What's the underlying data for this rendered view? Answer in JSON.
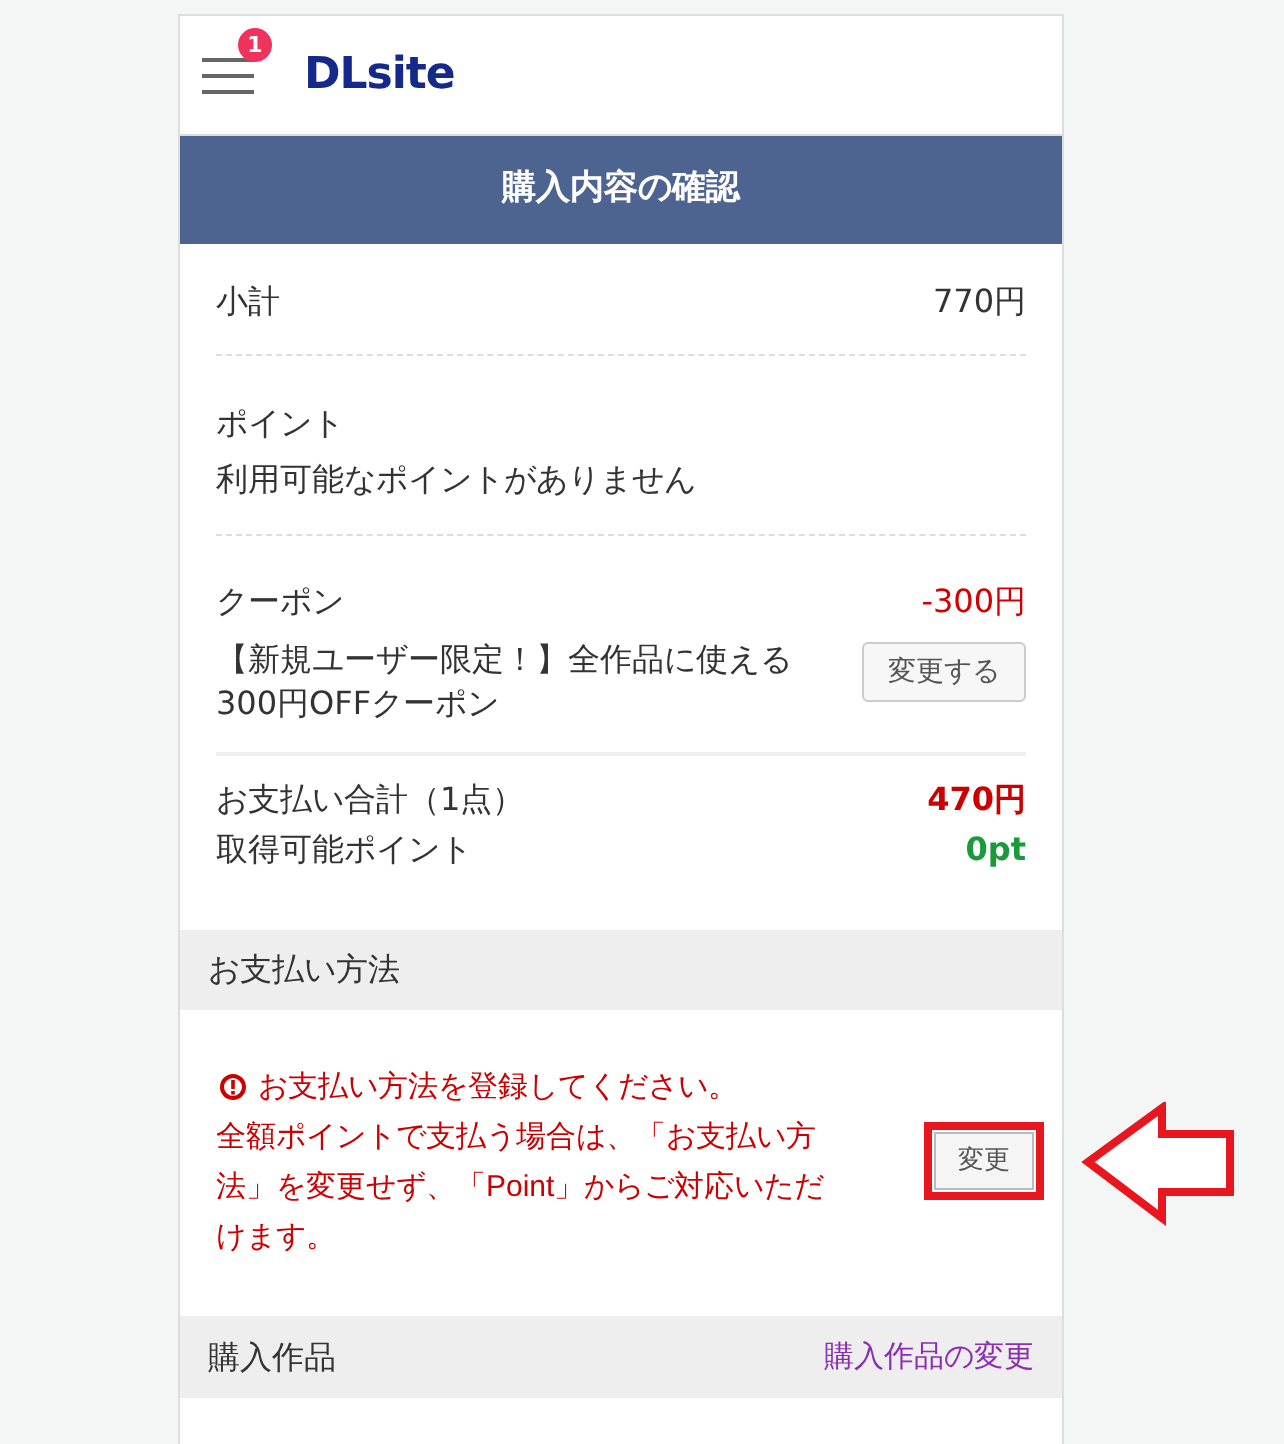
{
  "header": {
    "menu_badge": "1",
    "logo": "DLsite"
  },
  "title": "購入内容の確認",
  "summary": {
    "subtotal": {
      "label": "小計",
      "value": "770円"
    },
    "points": {
      "label": "ポイント",
      "note": "利用可能なポイントがありません"
    },
    "coupon": {
      "label": "クーポン",
      "value": "-300円",
      "description": "【新規ユーザー限定！】全作品に使える300円OFFクーポン",
      "button": "変更する"
    },
    "total": {
      "label": "お支払い合計（1点）",
      "value": "470円"
    },
    "earnable_points": {
      "label": "取得可能ポイント",
      "value": "0pt"
    }
  },
  "payment": {
    "heading": "お支払い方法",
    "warning": "お支払い方法を登録してください。",
    "note": "全額ポイントで支払う場合は、「お支払い方法」を変更せず、「Point」からご対応いただけます。",
    "change_button": {
      "label": "変更",
      "highlighted": true
    },
    "pointer_arrow": true
  },
  "purchased_items": {
    "heading": "購入作品",
    "link": "購入作品の変更"
  }
}
